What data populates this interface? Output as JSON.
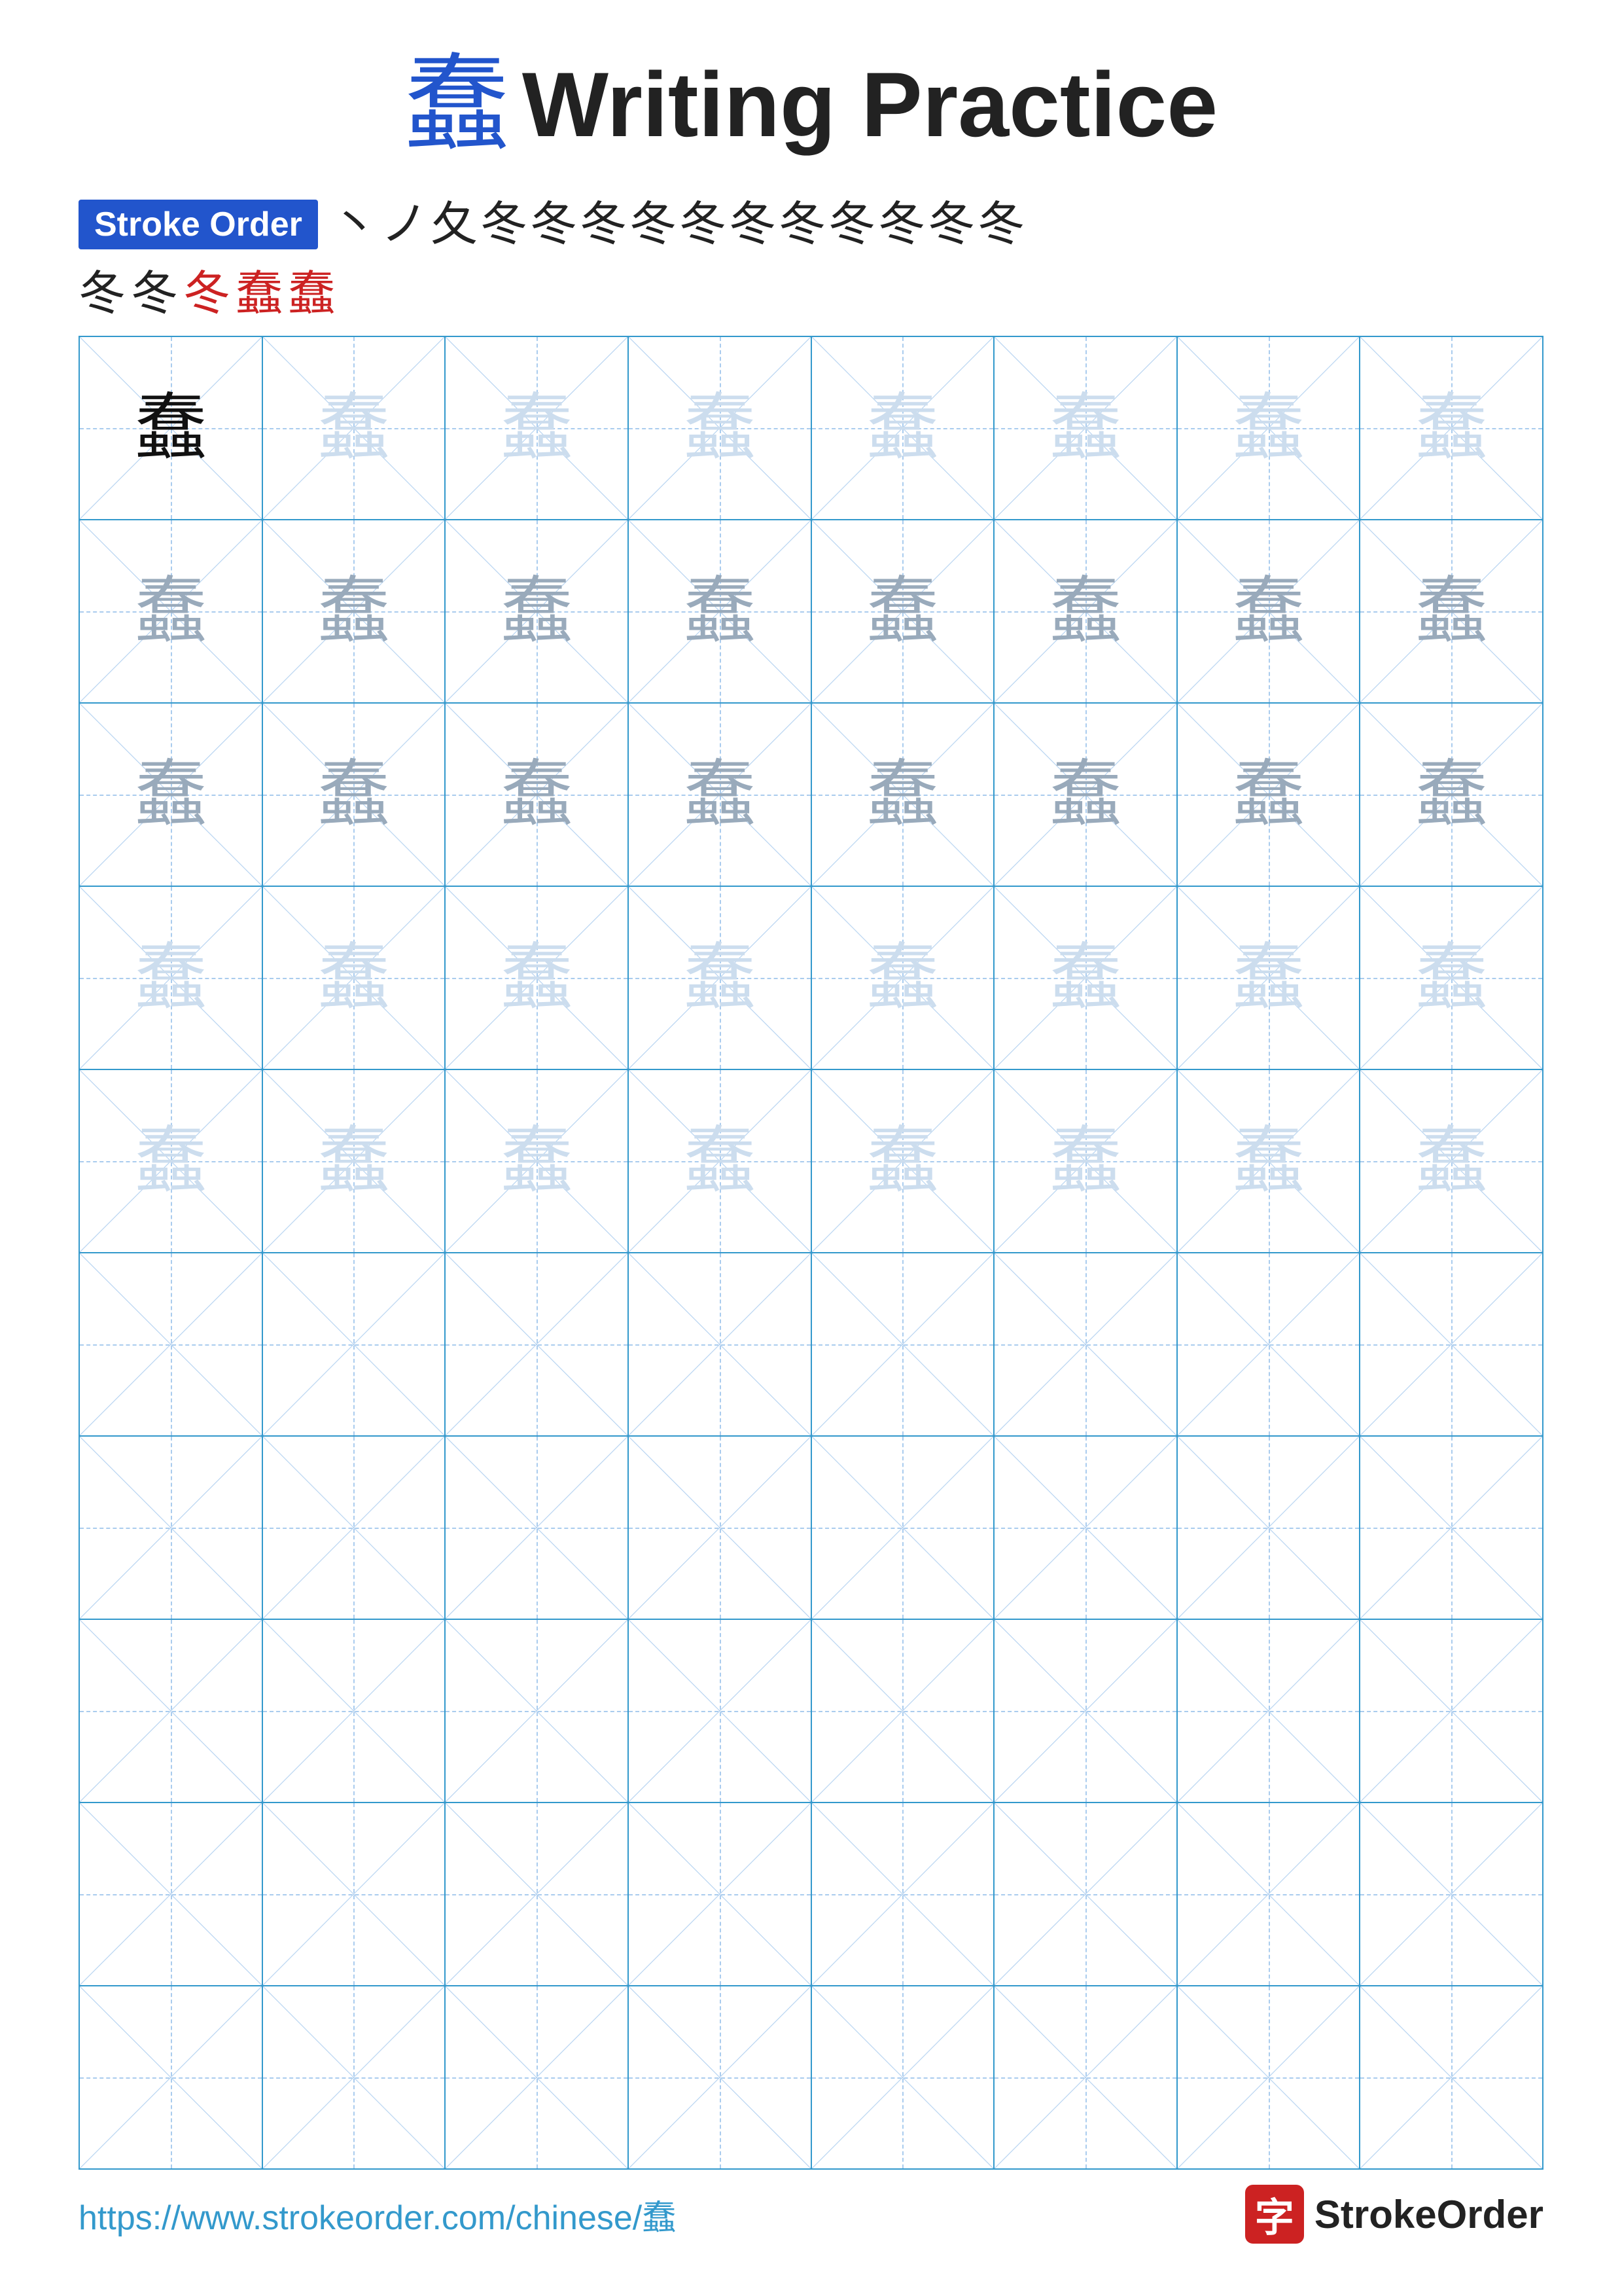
{
  "title": {
    "char": "蠢",
    "text": "Writing Practice"
  },
  "stroke_order": {
    "badge_label": "Stroke Order",
    "strokes": [
      "丶",
      "ノ",
      "夂",
      "冬",
      "冬",
      "冬",
      "冬",
      "冬",
      "冬",
      "冬",
      "冬",
      "冬",
      "冬",
      "冬",
      "冬",
      "冬",
      "冬"
    ]
  },
  "grid": {
    "char": "蠢",
    "rows": 10,
    "cols": 8,
    "practice_rows_with_char": 5,
    "practice_rows_empty": 5
  },
  "footer": {
    "url": "https://www.strokeorder.com/chinese/蠢",
    "brand_icon": "字",
    "brand_name": "StrokeOrder"
  }
}
